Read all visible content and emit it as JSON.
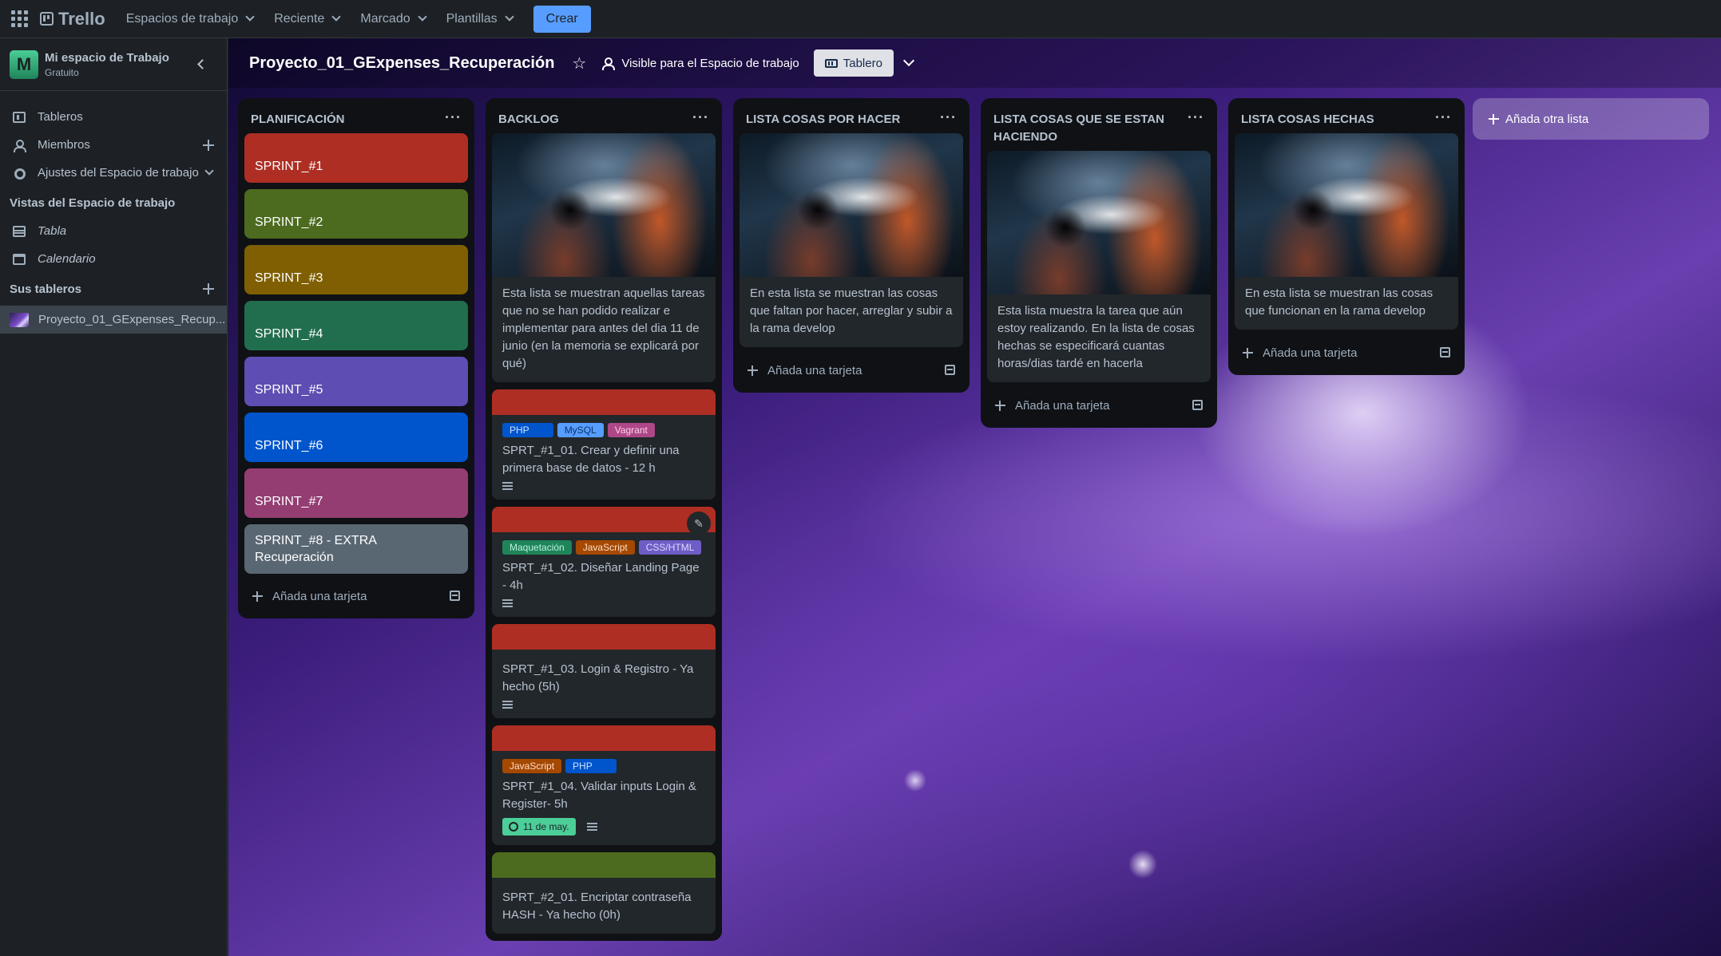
{
  "topbar": {
    "logo": "Trello",
    "nav": [
      "Espacios de trabajo",
      "Reciente",
      "Marcado",
      "Plantillas"
    ],
    "create": "Crear"
  },
  "sidebar": {
    "workspace_initial": "M",
    "workspace_name": "Mi espacio de Trabajo",
    "workspace_plan": "Gratuito",
    "items": [
      {
        "label": "Tableros"
      },
      {
        "label": "Miembros"
      },
      {
        "label": "Ajustes del Espacio de trabajo"
      }
    ],
    "views_title": "Vistas del Espacio de trabajo",
    "views": [
      {
        "label": "Tabla"
      },
      {
        "label": "Calendario"
      }
    ],
    "boards_title": "Sus tableros",
    "boards": [
      {
        "label": "Proyecto_01_GExpenses_Recup..."
      }
    ]
  },
  "board": {
    "title": "Proyecto_01_GExpenses_Recuperación",
    "visibility": "Visible para el Espacio de trabajo",
    "view": "Tablero",
    "add_list": "Añada otra lista",
    "add_card": "Añada una tarjeta"
  },
  "lists": {
    "planning": {
      "title": "PLANIFICACIÓN",
      "cards": [
        {
          "label": "SPRINT_#1",
          "color": "#ae2e24"
        },
        {
          "label": "SPRINT_#2",
          "color": "#4c6b1f"
        },
        {
          "label": "SPRINT_#3",
          "color": "#7f5f01"
        },
        {
          "label": "SPRINT_#4",
          "color": "#216e4e"
        },
        {
          "label": "SPRINT_#5",
          "color": "#5e4db2"
        },
        {
          "label": "SPRINT_#6",
          "color": "#0055cc"
        },
        {
          "label": "SPRINT_#7",
          "color": "#943d73"
        },
        {
          "label": "SPRINT_#8 - EXTRA Recuperación",
          "color": "#596773"
        }
      ]
    },
    "backlog": {
      "title": "BACKLOG",
      "intro": "Esta lista se muestran aquellas tareas que no se han podido realizar e implementar para antes del dia 11 de junio (en la memoria se explicará por qué)",
      "cards": [
        {
          "title": "SPRT_#1_01. Crear y definir una primera base de datos - 12 h",
          "labels": [
            "PHP",
            "MySQL",
            "Vagrant"
          ]
        },
        {
          "title": "SPRT_#1_02. Diseñar Landing Page - 4h",
          "labels": [
            "Maquetación",
            "JavaScript",
            "CSS/HTML"
          ]
        },
        {
          "title": "SPRT_#1_03. Login & Registro - Ya hecho (5h)"
        },
        {
          "title": "SPRT_#1_04. Validar inputs Login & Register- 5h",
          "labels": [
            "JavaScript",
            "PHP"
          ],
          "date": "11 de may."
        },
        {
          "title": "SPRT_#2_01. Encriptar contraseña HASH - Ya hecho (0h)"
        }
      ]
    },
    "todo": {
      "title": "LISTA COSAS POR HACER",
      "intro": "En esta lista se muestran las cosas que faltan por hacer, arreglar y subir a la rama develop"
    },
    "doing": {
      "title": "LISTA COSAS QUE SE ESTAN HACIENDO",
      "intro": "Esta lista muestra la tarea que aún estoy realizando. En la lista de cosas hechas se especificará cuantas horas/dias tardé en hacerla"
    },
    "done": {
      "title": "LISTA COSAS HECHAS",
      "intro": "En esta lista se muestran las cosas que funcionan en la rama develop"
    }
  },
  "colors": {
    "label_php": "#0055cc",
    "label_mysql": "#579dff",
    "label_vagrant": "#ae4787",
    "label_maquetacion": "#1f845a",
    "label_javascript": "#a54800",
    "label_csshtml": "#6e5dc6",
    "cover_red": "#ae2e24",
    "cover_green": "#4c6b1f"
  }
}
